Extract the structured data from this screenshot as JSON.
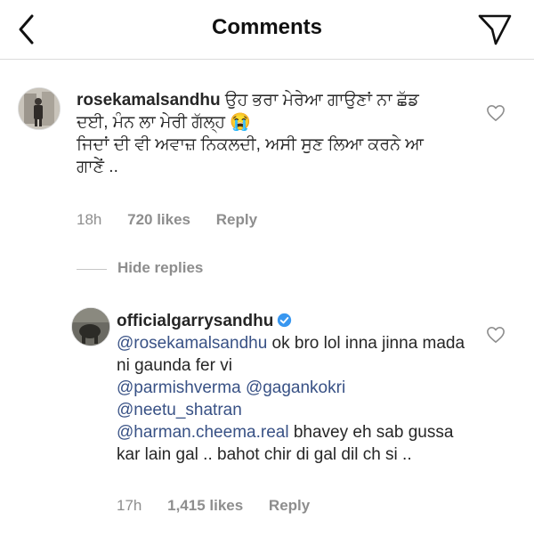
{
  "header": {
    "title": "Comments"
  },
  "comment": {
    "username": "rosekamalsandhu",
    "text_line1": "ਉਹ ਭਰਾ ਮੇਰੇਆ ਗਾਉਣਾਂ ਨਾ ਛੱਡ",
    "text_line2": "ਦਈ, ਮੰਨ ਲਾ ਮੇਰੀ ਗੱਲ੍ਹ 😭",
    "text_line3": "ਜਿਦਾਂ ਦੀ ਵੀ ਅਵਾਜ਼ ਨਿਕਲਦੀ, ਅਸੀ ਸੁਣ ਲਿਆ ਕਰਨੇ ਆ",
    "text_line4": "ਗਾਣੇਂ ..",
    "time": "18h",
    "likes": "720 likes",
    "reply_label": "Reply"
  },
  "hide_replies_label": "Hide replies",
  "reply": {
    "username": "officialgarrysandhu",
    "mention1": "@rosekamalsandhu",
    "text1": " ok bro lol inna jinna mada ni gaunda fer vi",
    "mention2": "@parmishverma",
    "mention3": "@gagankokri",
    "mention4": "@neetu_shatran",
    "mention5": "@harman.cheema.real",
    "text2": " bhavey eh sab gussa kar lain gal .. bahot chir di gal dil ch si ..",
    "time": "17h",
    "likes": "1,415 likes",
    "reply_label": "Reply"
  },
  "icons": {
    "back": "chevron-left-icon",
    "send": "paper-plane-icon",
    "like": "heart-outline-icon",
    "verified": "verified-badge-icon"
  },
  "colors": {
    "mention": "#385185",
    "verified": "#3897f0",
    "meta": "#8e8e8e"
  }
}
